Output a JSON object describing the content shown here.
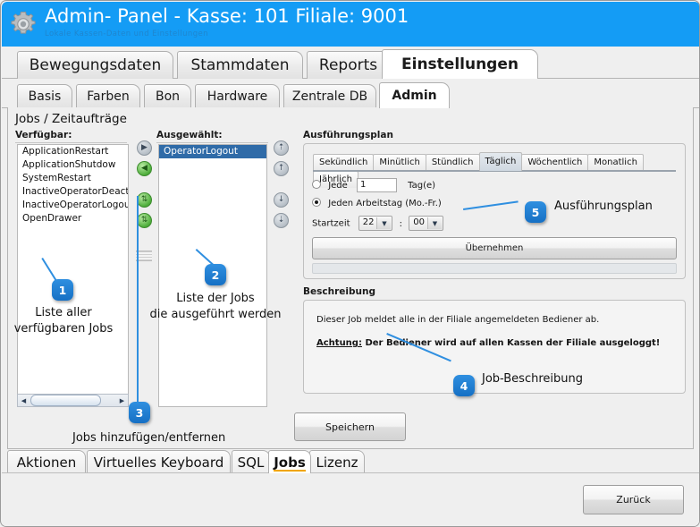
{
  "window": {
    "title": "Admin- Panel - Kasse: 101 Filiale: 9001",
    "subtitle": "Lokale Kassen-Daten und Einstellungen",
    "gear_icon": "gear-icon",
    "accent_color": "#149cf5"
  },
  "main_tabs": [
    {
      "label": "Bewegungsdaten",
      "active": false
    },
    {
      "label": "Stammdaten",
      "active": false
    },
    {
      "label": "Reports",
      "active": false
    },
    {
      "label": "Einstellungen",
      "active": true
    }
  ],
  "sub_tabs": [
    {
      "label": "Basis",
      "active": false
    },
    {
      "label": "Farben",
      "active": false
    },
    {
      "label": "Bon",
      "active": false
    },
    {
      "label": "Hardware",
      "active": false
    },
    {
      "label": "Zentrale DB",
      "active": false
    },
    {
      "label": "Admin",
      "active": true
    }
  ],
  "panel": {
    "section_title": "Jobs / Zeitaufträge",
    "available": {
      "label": "Verfügbar:",
      "items": [
        "ApplicationRestart",
        "ApplicationShutdow",
        "SystemRestart",
        "InactiveOperatorDeactivatio",
        "InactiveOperatorLogout",
        "OpenDrawer"
      ]
    },
    "selected": {
      "label": "Ausgewählt:",
      "items": [
        "OperatorLogout"
      ],
      "selected_index": 0
    },
    "transfer_buttons": [
      {
        "name": "move-right-button",
        "glyph": "▶",
        "state": "disabled"
      },
      {
        "name": "move-left-button",
        "glyph": "◀",
        "state": "enabled"
      },
      {
        "name": "move-all-right-button",
        "glyph": "▶",
        "state": "enabled"
      },
      {
        "name": "move-all-left-button",
        "glyph": "◀",
        "state": "enabled"
      }
    ],
    "order_buttons": [
      {
        "name": "move-to-top-button",
        "glyph": "⇈",
        "state": "disabled"
      },
      {
        "name": "move-up-button",
        "glyph": "↑",
        "state": "disabled"
      },
      {
        "name": "move-down-button",
        "glyph": "↓",
        "state": "disabled"
      },
      {
        "name": "move-to-bottom-button",
        "glyph": "⇊",
        "state": "disabled"
      }
    ]
  },
  "schedule": {
    "group_title": "Ausführungsplan",
    "tabs": [
      {
        "label": "Sekündlich",
        "active": false
      },
      {
        "label": "Minütlich",
        "active": false
      },
      {
        "label": "Stündlich",
        "active": false
      },
      {
        "label": "Täglich",
        "active": true
      },
      {
        "label": "Wöchentlich",
        "active": false
      },
      {
        "label": "Monatlich",
        "active": false
      },
      {
        "label": "Jährlich",
        "active": false
      }
    ],
    "every_radio_label": "Jede",
    "every_radio_checked": false,
    "every_value": "1",
    "every_unit": "Tag(e)",
    "workday_radio_label": "Jeden Arbeitstag (Mo.-Fr.)",
    "workday_radio_checked": true,
    "start_label": "Startzeit",
    "start_hour": "22",
    "start_separator": ":",
    "start_minute": "00",
    "apply_button": "Übernehmen"
  },
  "description": {
    "group_title": "Beschreibung",
    "line1": "Dieser Job meldet alle in der Filiale angemeldeten Bediener ab.",
    "warn_prefix": "Achtung:",
    "warn_text": "Der Bediener wird auf allen Kassen der Filiale ausgeloggt!"
  },
  "save_button": "Speichern",
  "back_button": "Zurück",
  "bottom_tabs": [
    {
      "label": "Aktionen",
      "active": false
    },
    {
      "label": "Virtuelles Keyboard",
      "active": false
    },
    {
      "label": "SQL",
      "active": false
    },
    {
      "label": "Jobs",
      "active": true
    },
    {
      "label": "Lizenz",
      "active": false
    }
  ],
  "annotations": [
    {
      "number": "1",
      "text": "Liste aller\nverfügbaren Jobs"
    },
    {
      "number": "2",
      "text": "Liste der Jobs\ndie ausgeführt werden"
    },
    {
      "number": "3",
      "text": "Jobs hinzufügen/entfernen"
    },
    {
      "number": "4",
      "text": "Job-Beschreibung"
    },
    {
      "number": "5",
      "text": "Ausführungsplan"
    }
  ]
}
